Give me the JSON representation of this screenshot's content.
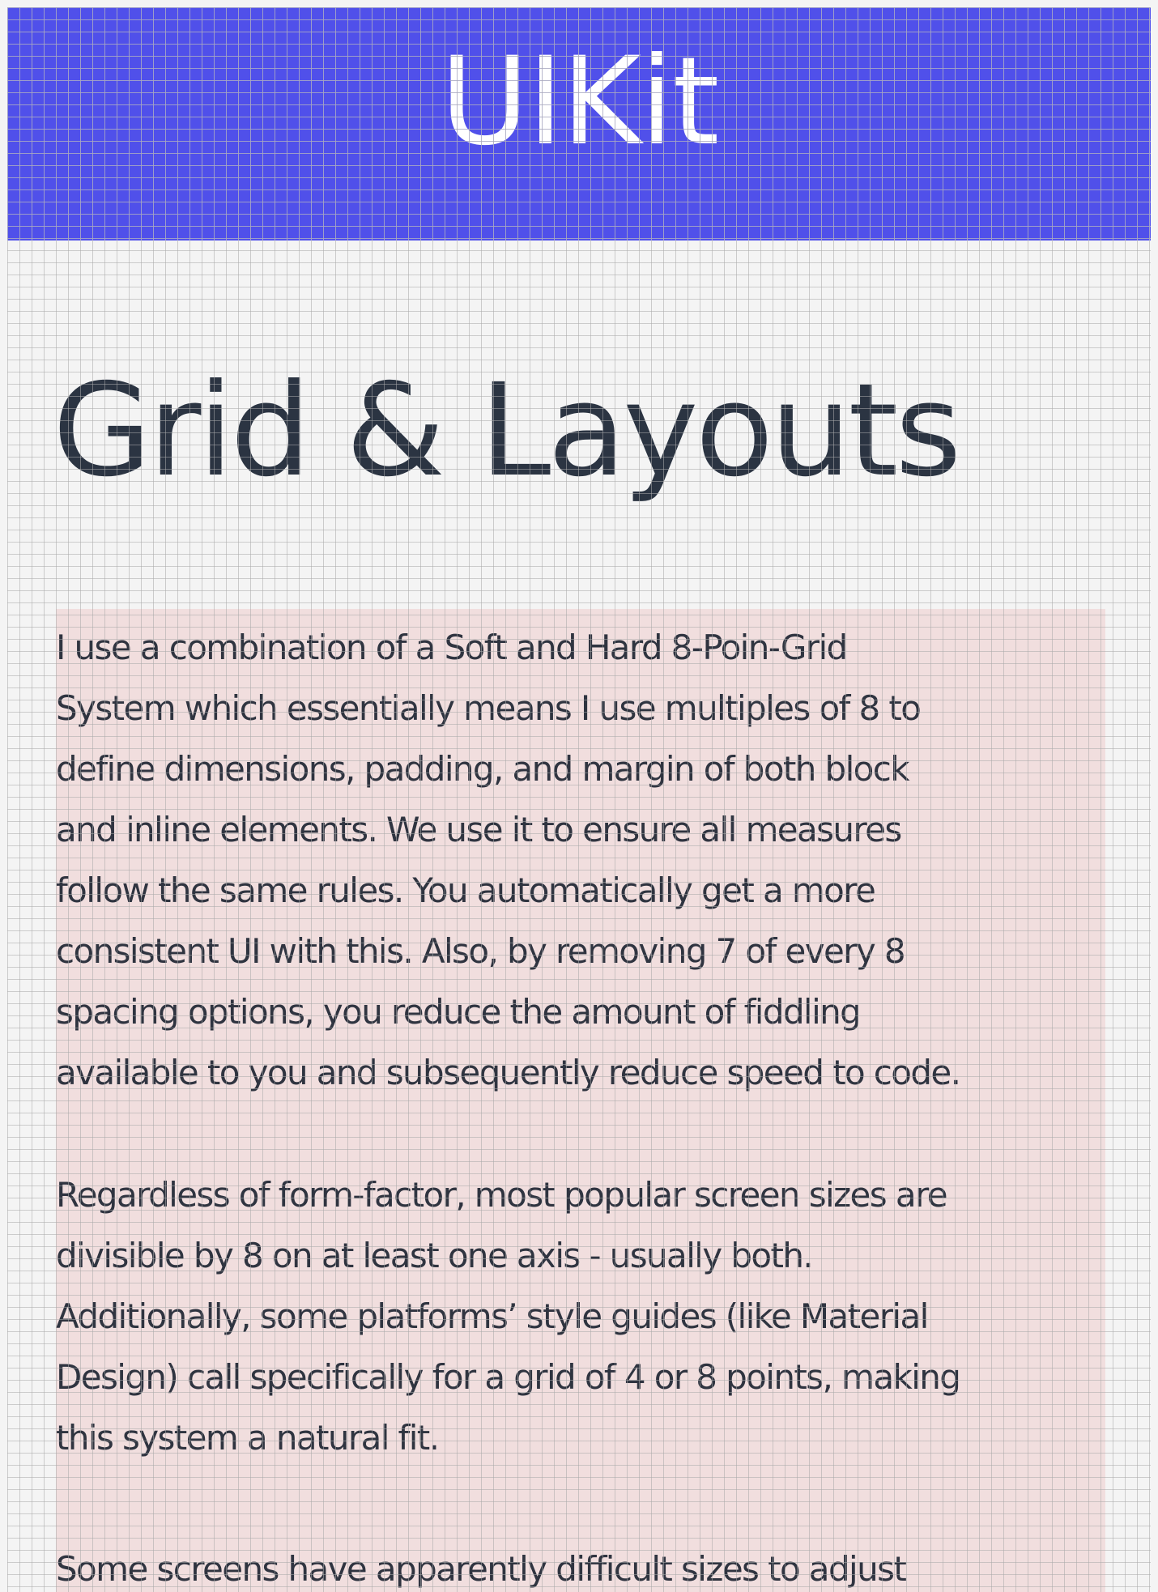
{
  "header": {
    "title": "UIKit"
  },
  "main": {
    "title": "Grid & Layouts",
    "paragraphs": [
      "I use a combination of a Soft and Hard 8-Poin-Grid\nSystem which essentially means I use multiples of 8 to\ndefine dimensions, padding, and margin of both block\nand inline elements. We use it to ensure all measures\nfollow the same rules. You automatically get a more\nconsistent UI with this. Also, by removing 7 of every 8\nspacing options, you reduce the amount of fiddling\navailable to you and subsequently reduce speed to code.",
      "Regardless of form-factor, most popular screen sizes are\ndivisible by 8 on at least one axis - usually both.\nAdditionally, some platforms’ style guides (like Material\nDesign) call specifically for a grid of 4 or 8 points, making\nthis system a natural fit.",
      "Some screens have apparently difficult sizes to adjust"
    ]
  },
  "colors": {
    "header_background": "#5050ea",
    "page_background": "#f4f4f4",
    "content_background": "#f1dede",
    "text": "#2f3440",
    "grid_lines": "#aaaaaa"
  }
}
